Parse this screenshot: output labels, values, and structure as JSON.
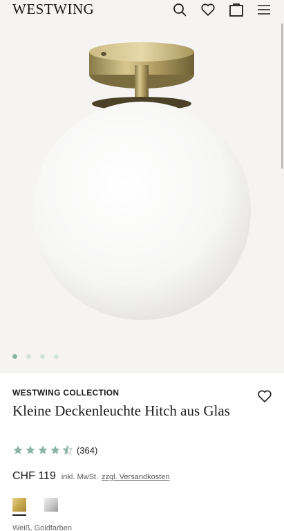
{
  "header": {
    "logo": "WESTWING",
    "icons": [
      "search-icon",
      "heart-icon",
      "bag-icon",
      "menu-icon"
    ]
  },
  "gallery": {
    "image_count": 4,
    "active_index": 0
  },
  "product": {
    "brand": "WESTWING COLLECTION",
    "title": "Kleine Deckenleuchte Hitch aus Glas",
    "rating_value": 4.5,
    "rating_max": 5,
    "rating_count": "(364)",
    "price": "CHF 119",
    "vat": "inkl. MwSt.",
    "shipping": "zzgl. Versandkosten",
    "variant_label": "Weiß, Goldfarben",
    "swatches": [
      "gold",
      "silver"
    ]
  },
  "colors": {
    "accent": "#8cb5a8",
    "star": "#8cb5a8",
    "background": "#f5f4f2"
  }
}
